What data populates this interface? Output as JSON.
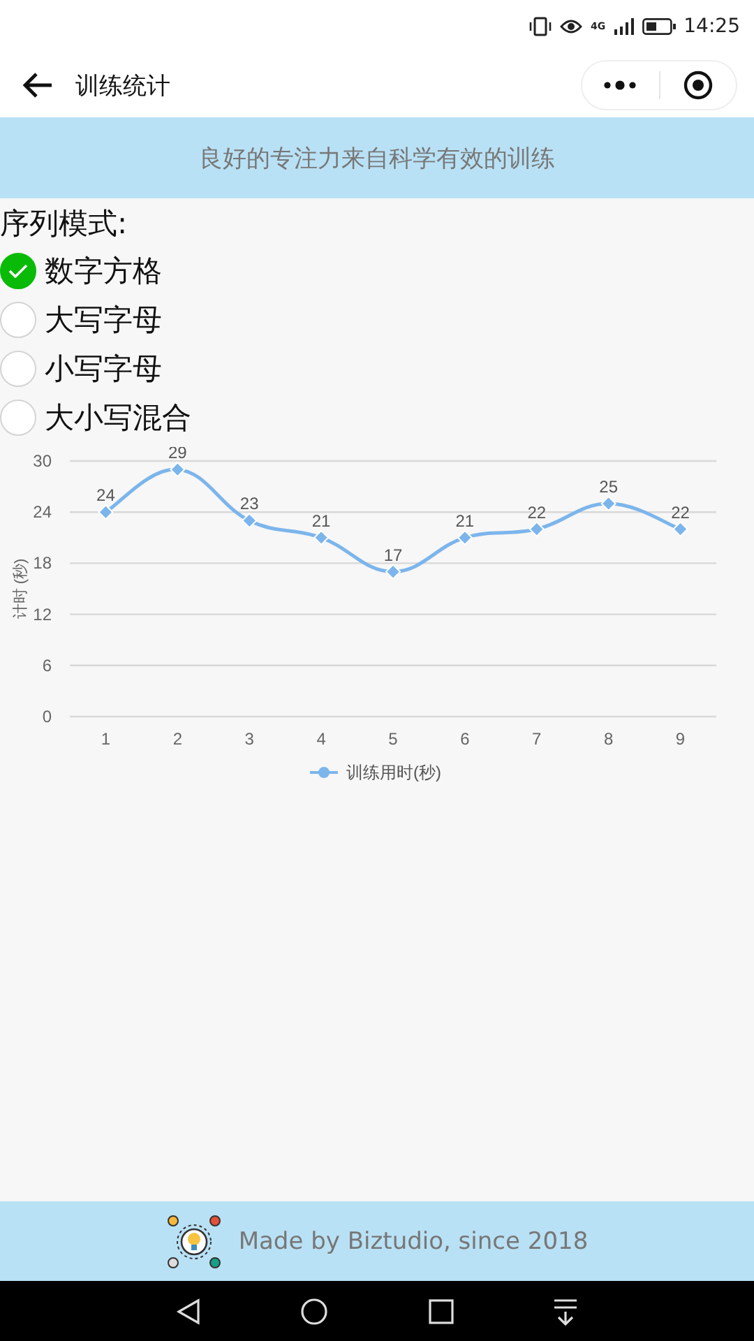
{
  "status_bar": {
    "time": "14:25",
    "network": "4G"
  },
  "nav": {
    "title": "训练统计"
  },
  "banner": "良好的专注力来自科学有效的训练",
  "mode_label": "序列模式:",
  "options": [
    {
      "label": "数字方格",
      "selected": true
    },
    {
      "label": "大写字母",
      "selected": false
    },
    {
      "label": "小写字母",
      "selected": false
    },
    {
      "label": "大小写混合",
      "selected": false
    }
  ],
  "chart_data": {
    "type": "line",
    "ylabel": "计时 (秒)",
    "categories": [
      "1",
      "2",
      "3",
      "4",
      "5",
      "6",
      "7",
      "8",
      "9"
    ],
    "series": [
      {
        "name": "训练用时(秒)",
        "color": "#7cb5ec",
        "marker": "diamond",
        "values": [
          24,
          29,
          23,
          21,
          17,
          21,
          22,
          25,
          22
        ]
      }
    ],
    "grid": true,
    "ylim": [
      0,
      30
    ],
    "yticks": [
      0,
      6,
      12,
      18,
      24,
      30
    ],
    "data_labels": true
  },
  "footer": "Made by Biztudio, since 2018"
}
